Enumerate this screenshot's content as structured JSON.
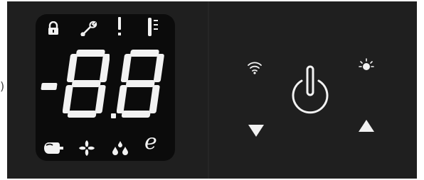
{
  "controller": {
    "edge_mark": ")",
    "display": {
      "sign": "-",
      "digits": [
        "8",
        "8"
      ],
      "decimal_point": true,
      "icons": {
        "top": [
          "lock-icon",
          "wrench-icon",
          "alert-icon",
          "thermometer-icon"
        ],
        "bottom": [
          "compressor-icon",
          "fan-icon",
          "defrost-drops-icon",
          "eco-icon"
        ]
      },
      "eco_label": "e"
    },
    "buttons": {
      "wifi": "wifi-icon",
      "power": "power-icon",
      "light": "light-icon",
      "down": "down-arrow-icon",
      "up": "up-arrow-icon"
    },
    "colors": {
      "panel": "#1f1f1f",
      "display_bg": "#0b0b0b",
      "foreground": "#f2f2f2"
    }
  }
}
